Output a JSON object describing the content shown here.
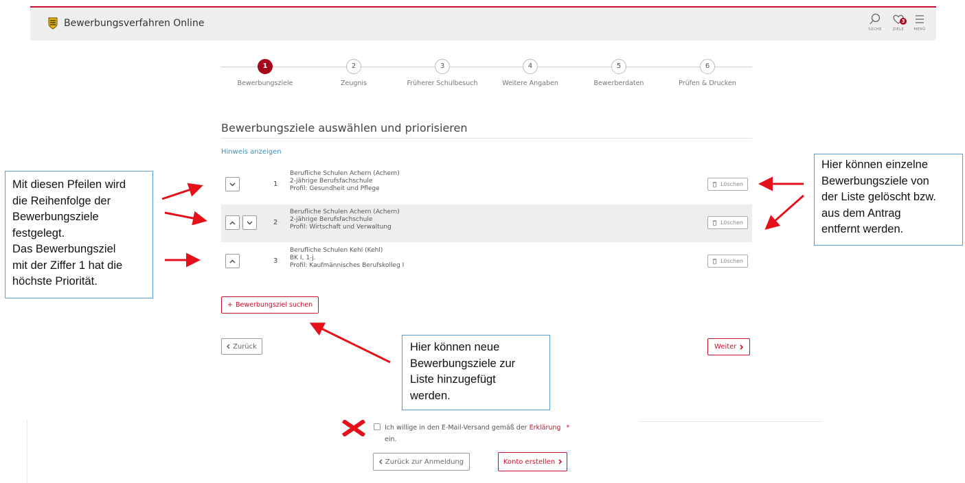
{
  "colors": {
    "accent": "#c8102e",
    "step_active": "#a5071b",
    "link": "#3d8fb8",
    "callout_border": "#5b9bd5"
  },
  "header": {
    "title": "Bewerbungsverfahren Online",
    "logo_icon": "coat-of-arms-icon",
    "icons": [
      {
        "icon": "search-icon",
        "label": "SUCHE"
      },
      {
        "icon": "heart-icon",
        "label": "ZIELE",
        "badge": "3"
      },
      {
        "icon": "menu-icon",
        "label": "MENÜ"
      }
    ]
  },
  "stepper": {
    "current": 1,
    "steps": [
      {
        "num": "1",
        "label": "Bewerbungsziele"
      },
      {
        "num": "2",
        "label": "Zeugnis"
      },
      {
        "num": "3",
        "label": "Früherer Schulbesuch"
      },
      {
        "num": "4",
        "label": "Weitere Angaben"
      },
      {
        "num": "5",
        "label": "Bewerberdaten"
      },
      {
        "num": "6",
        "label": "Prüfen & Drucken"
      }
    ]
  },
  "main": {
    "title": "Bewerbungsziele auswählen und priorisieren",
    "hint_link": "Hinweis anzeigen",
    "delete_label": "Löschen",
    "add_label": "Bewerbungsziel suchen",
    "back_label": "Zurück",
    "next_label": "Weiter",
    "items": [
      {
        "num": "1",
        "school": "Berufliche Schulen Achern (Achern)",
        "program": "2-jährige Berufsfachschule",
        "profile": "Profil: Gesundheit und Pflege"
      },
      {
        "num": "2",
        "school": "Berufliche Schulen Achern (Achern)",
        "program": "2-jährige Berufsfachschule",
        "profile": "Profil: Wirtschaft und Verwaltung"
      },
      {
        "num": "3",
        "school": "Berufliche Schulen Kehl (Kehl)",
        "program": "BK I, 1-j.",
        "profile": "Profil: Kaufmännisches Berufskolleg I"
      }
    ]
  },
  "callouts": {
    "left": [
      "Mit diesen Pfeilen wird",
      "die Reihenfolge der",
      "Bewerbungsziele",
      "festgelegt.",
      "Das Bewerbungsziel",
      "mit der Ziffer 1 hat die",
      "höchste Priorität."
    ],
    "right": [
      "Hier können einzelne",
      "Bewerbungsziele von",
      "der Liste gelöscht bzw.",
      "aus dem Antrag",
      "entfernt werden."
    ],
    "bottom": [
      "Hier können neue",
      "Bewerbungsziele zur",
      "Liste hinzugefügt",
      "werden."
    ]
  },
  "consent": {
    "text_before": "Ich willige in den E-Mail-Versand gemäß der",
    "link": "Erklärung",
    "required_mark": "*",
    "text_after": "ein.",
    "back_login_label": "Zurück zur Anmeldung",
    "create_account_label": "Konto erstellen"
  }
}
